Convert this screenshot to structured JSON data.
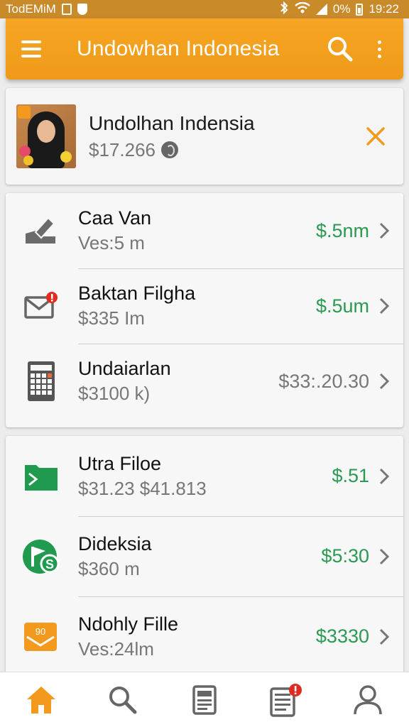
{
  "status_bar": {
    "carrier": "TodEMiM",
    "battery": "0%",
    "time": "19:22"
  },
  "app_bar": {
    "title": "Undowhan Indonesia"
  },
  "profile": {
    "name": "Undolhan Indensia",
    "amount": "$17.266"
  },
  "list_group_1": [
    {
      "icon": "edit-icon",
      "title": "Caa Van",
      "subtitle": "Ves:5 m",
      "value": "$.5nm"
    },
    {
      "icon": "mail-alert-icon",
      "title": "Baktan Filgha",
      "subtitle": "$335 Im",
      "value": "$.5um"
    },
    {
      "icon": "calculator-icon",
      "title": "Undaiarlan",
      "subtitle": "$3100 k)",
      "value": "$33:.20.30"
    }
  ],
  "list_group_2": [
    {
      "icon": "folder-icon",
      "title": "Utra Filoe",
      "subtitle": "$31.23 $41.813",
      "value": "$.51"
    },
    {
      "icon": "money-flag-icon",
      "title": "Dideksia",
      "subtitle": "$360 m",
      "value": "$5:30"
    },
    {
      "icon": "envelope-90-icon",
      "title": "Ndohly Fille",
      "subtitle": "Ves:24lm",
      "value": "$3330",
      "icon_text": "90"
    }
  ],
  "bottom_nav": [
    {
      "icon": "home-icon"
    },
    {
      "icon": "search-icon"
    },
    {
      "icon": "document-icon"
    },
    {
      "icon": "list-alert-icon"
    },
    {
      "icon": "profile-icon"
    }
  ],
  "colors": {
    "accent": "#f3a020",
    "value_green": "#2a9a52",
    "value_grey": "#777777",
    "alert_red": "#e02b20"
  }
}
